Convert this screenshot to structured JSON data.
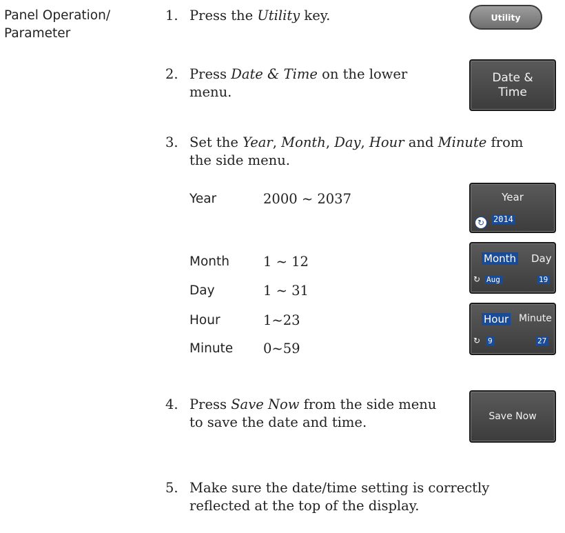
{
  "side_label": {
    "line1": "Panel Operation/",
    "line2": "Parameter"
  },
  "steps": [
    {
      "num": "1.",
      "pre": "Press the ",
      "em": "Utility",
      "post": " key."
    },
    {
      "num": "2.",
      "pre": "Press ",
      "em": "Date & Time",
      "post": " on the lower",
      "line2": "menu."
    },
    {
      "num": "3.",
      "pre": "Set the ",
      "em1": "Year",
      "c1": ", ",
      "em2": "Month",
      "c2": ", ",
      "em3": "Day",
      "c3": ", ",
      "em4": "Hour",
      "c4": " and ",
      "em5": "Minute",
      "post": " from",
      "line2": "the side menu."
    },
    {
      "num": "4.",
      "pre": "Press ",
      "em": "Save Now",
      "post": " from the side menu",
      "line2": "to save the date and time."
    },
    {
      "num": "5.",
      "line1": "Make sure the date/time setting is correctly",
      "line2": "reflected at the top of the display."
    }
  ],
  "ranges": [
    {
      "name": "Year",
      "value": "2000 ~ 2037"
    },
    {
      "name": "Month",
      "value": "1 ~ 12"
    },
    {
      "name": "Day",
      "value": "1 ~ 31"
    },
    {
      "name": "Hour",
      "value": "1~23"
    },
    {
      "name": "Minute",
      "value": "0~59"
    }
  ],
  "buttons": {
    "utility": "Utility",
    "date_time": {
      "line1": "Date &",
      "line2": "Time"
    },
    "year": {
      "label": "Year",
      "value": "2014"
    },
    "month_day": {
      "month_label": "Month",
      "day_label": "Day",
      "month_value": "Aug",
      "day_value": "19"
    },
    "hour_minute": {
      "hour_label": "Hour",
      "minute_label": "Minute",
      "hour_value": "9",
      "minute_value": "27"
    },
    "save_now": "Save Now"
  },
  "colors": {
    "highlight": "#1c4b95",
    "button_bg": "#4a4a4a",
    "text": "#222222"
  },
  "icons": {
    "knob": "variable-knob-icon"
  }
}
